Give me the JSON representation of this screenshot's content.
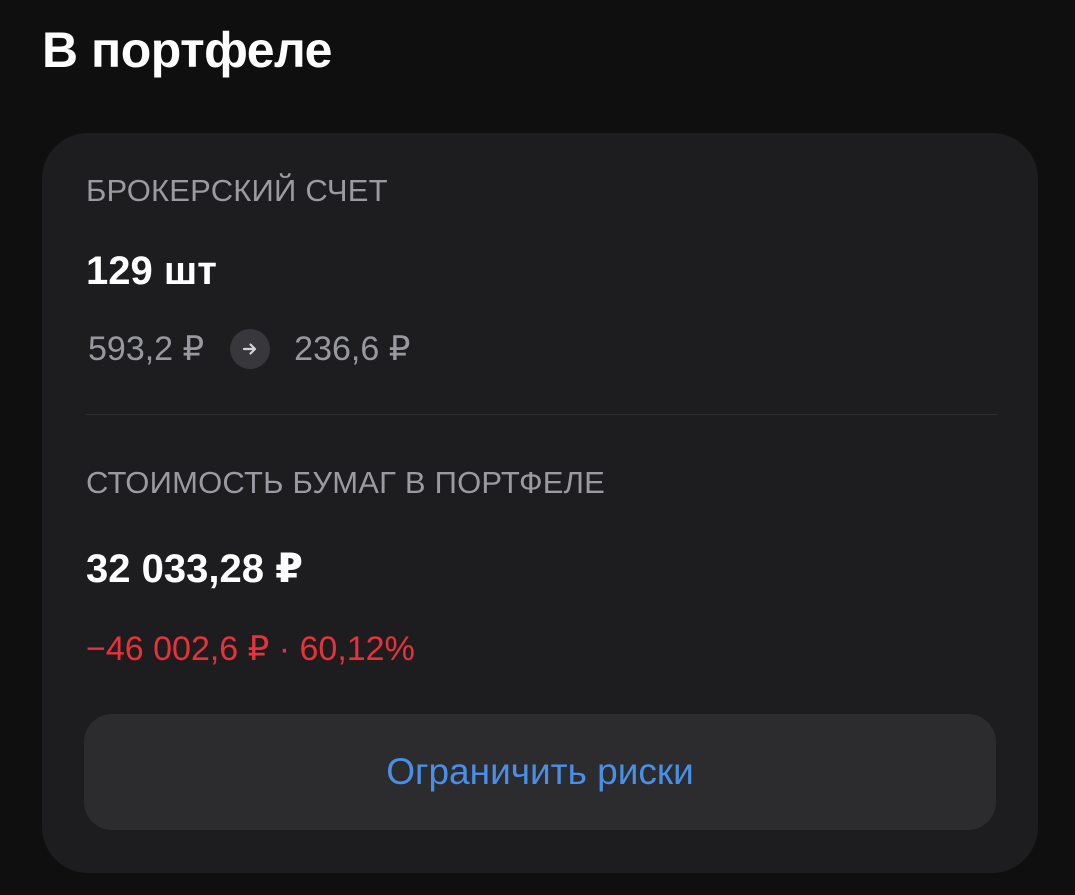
{
  "header": {
    "title": "В портфеле"
  },
  "card": {
    "account": {
      "label": "БРОКЕРСКИЙ СЧЕТ",
      "quantity": "129 шт",
      "price_from": "593,2 ₽",
      "arrow_icon": "arrow-right-icon",
      "price_to": "236,6 ₽"
    },
    "holdings": {
      "label": "СТОИМОСТЬ БУМАГ В ПОРТФЕЛЕ",
      "total_value": "32 033,28 ₽",
      "change_amount": "−46 002,6 ₽",
      "change_separator": " · ",
      "change_percent": "60,12%",
      "change_color": "#e8313a"
    },
    "action_button": {
      "label": "Ограничить риски",
      "color": "#4a8fe6"
    }
  },
  "colors": {
    "background": "#0f0f0f",
    "card": "#1d1d1f",
    "button": "#2c2c2f"
  }
}
